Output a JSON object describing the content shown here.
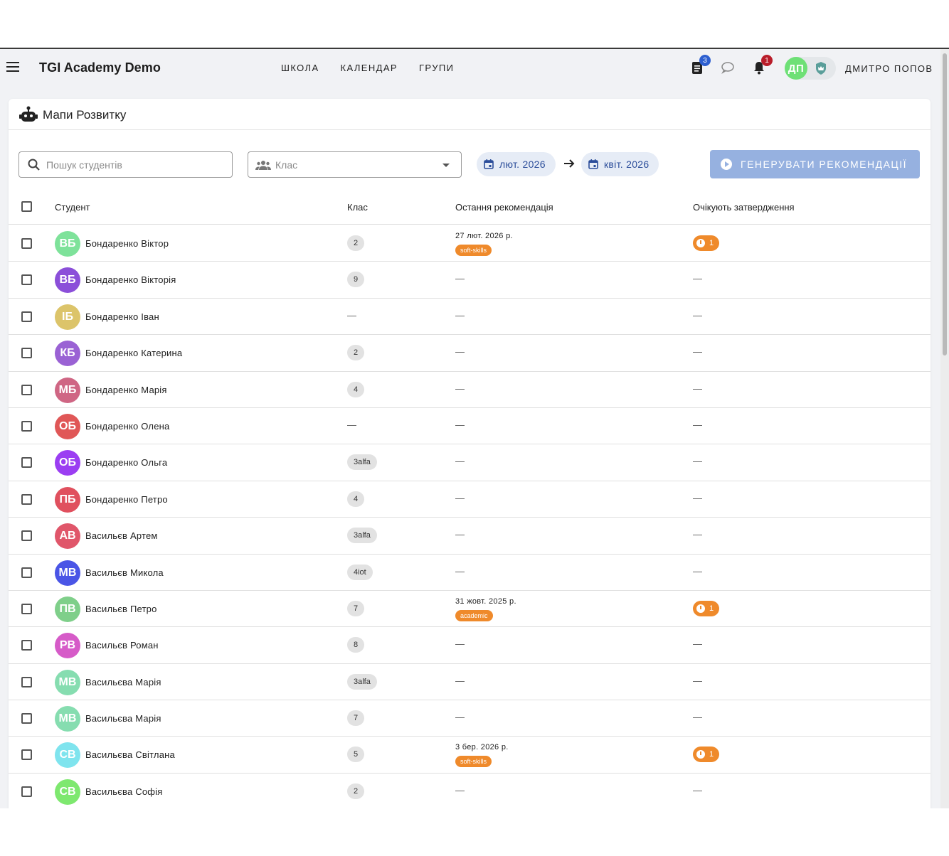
{
  "header": {
    "app_title": "TGI Academy Demo",
    "nav": [
      "ШКОЛА",
      "КАЛЕНДАР",
      "ГРУПИ"
    ],
    "tasks_badge": "3",
    "notifications_badge": "1",
    "user_initials": "ДП",
    "user_name": "ДМИТРО ПОПОВ"
  },
  "page": {
    "title": "Мапи Розвитку",
    "search_placeholder": "Пошук студентів",
    "class_placeholder": "Клас",
    "date_from": "лют. 2026",
    "date_to": "квіт. 2026",
    "generate_label": "ГЕНЕРУВАТИ РЕКОМЕНДАЦІЇ"
  },
  "table": {
    "columns": [
      "Студент",
      "Клас",
      "Остання рекомендація",
      "Очікують затвердження"
    ],
    "empty": "—",
    "rows": [
      {
        "initials": "ВБ",
        "color": "#7ee29a",
        "name": "Бондаренко Віктор",
        "class": "2",
        "rec_date": "27 лют. 2026 р.",
        "rec_tag": "soft-skills",
        "pending": "1"
      },
      {
        "initials": "ВБ",
        "color": "#8b4fd9",
        "name": "Бондаренко Вікторія",
        "class": "9",
        "rec_date": "",
        "rec_tag": "",
        "pending": ""
      },
      {
        "initials": "ІБ",
        "color": "#dcc46a",
        "name": "Бондаренко Іван",
        "class": "",
        "rec_date": "",
        "rec_tag": "",
        "pending": ""
      },
      {
        "initials": "КБ",
        "color": "#9a62d4",
        "name": "Бондаренко Катерина",
        "class": "2",
        "rec_date": "",
        "rec_tag": "",
        "pending": ""
      },
      {
        "initials": "МБ",
        "color": "#cf6684",
        "name": "Бондаренко Марія",
        "class": "4",
        "rec_date": "",
        "rec_tag": "",
        "pending": ""
      },
      {
        "initials": "ОБ",
        "color": "#e05757",
        "name": "Бондаренко Олена",
        "class": "",
        "rec_date": "",
        "rec_tag": "",
        "pending": ""
      },
      {
        "initials": "ОБ",
        "color": "#9b3ef2",
        "name": "Бондаренко Ольга",
        "class": "3alfa",
        "rec_date": "",
        "rec_tag": "",
        "pending": ""
      },
      {
        "initials": "ПБ",
        "color": "#e0505e",
        "name": "Бондаренко Петро",
        "class": "4",
        "rec_date": "",
        "rec_tag": "",
        "pending": ""
      },
      {
        "initials": "АВ",
        "color": "#e0566a",
        "name": "Васильєв Артем",
        "class": "3alfa",
        "rec_date": "",
        "rec_tag": "",
        "pending": ""
      },
      {
        "initials": "МВ",
        "color": "#4a55e6",
        "name": "Васильєв Микола",
        "class": "4iot",
        "rec_date": "",
        "rec_tag": "",
        "pending": ""
      },
      {
        "initials": "ПВ",
        "color": "#7fcf8a",
        "name": "Васильєв Петро",
        "class": "7",
        "rec_date": "31 жовт. 2025 р.",
        "rec_tag": "academic",
        "pending": "1"
      },
      {
        "initials": "РВ",
        "color": "#d65bc8",
        "name": "Васильєв Роман",
        "class": "8",
        "rec_date": "",
        "rec_tag": "",
        "pending": ""
      },
      {
        "initials": "МВ",
        "color": "#86ddb0",
        "name": "Васильєва Марія",
        "class": "3alfa",
        "rec_date": "",
        "rec_tag": "",
        "pending": ""
      },
      {
        "initials": "МВ",
        "color": "#86ddb0",
        "name": "Васильєва Марія",
        "class": "7",
        "rec_date": "",
        "rec_tag": "",
        "pending": ""
      },
      {
        "initials": "СВ",
        "color": "#7fe4ee",
        "name": "Васильєва Світлана",
        "class": "5",
        "rec_date": "3 бер. 2026 р.",
        "rec_tag": "soft-skills",
        "pending": "1"
      },
      {
        "initials": "СВ",
        "color": "#7ee86f",
        "name": "Васильєва Софія",
        "class": "2",
        "rec_date": "",
        "rec_tag": "",
        "pending": ""
      }
    ]
  }
}
